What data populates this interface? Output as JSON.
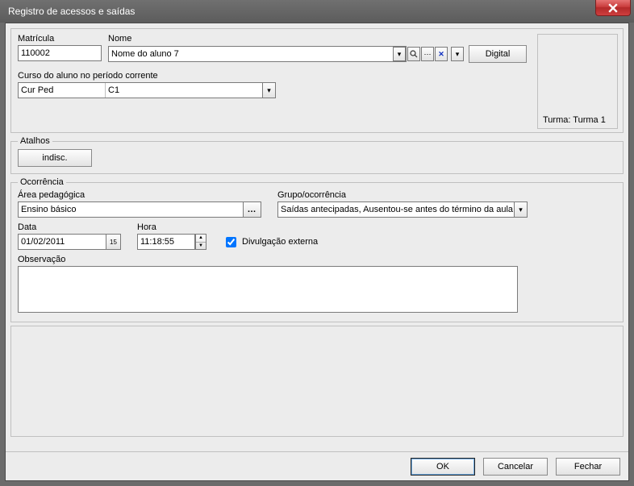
{
  "window": {
    "title": "Registro de acessos e saídas"
  },
  "top": {
    "matricula_label": "Matrícula",
    "matricula_value": "110002",
    "nome_label": "Nome",
    "nome_value": "Nome do aluno 7",
    "digital_label": "Digital",
    "curso_label": "Curso do aluno no período corrente",
    "curso_col1": "Cur Ped",
    "curso_col2": "C1",
    "turma_label": "Turma: Turma 1"
  },
  "atalhos": {
    "legend": "Atalhos",
    "indisc_label": "indisc."
  },
  "ocorrencia": {
    "legend": "Ocorrência",
    "area_label": "Área pedagógica",
    "area_value": "Ensino básico",
    "grupo_label": "Grupo/ocorrência",
    "grupo_value": "Saídas antecipadas, Ausentou-se antes do término da aula.",
    "data_label": "Data",
    "data_value": "01/02/2011",
    "hora_label": "Hora",
    "hora_value": "11:18:55",
    "divulgacao_label": "Divulgação externa",
    "divulgacao_checked": true,
    "obs_label": "Observação",
    "obs_value": ""
  },
  "footer": {
    "ok_label": "OK",
    "cancel_label": "Cancelar",
    "close_label": "Fechar"
  }
}
